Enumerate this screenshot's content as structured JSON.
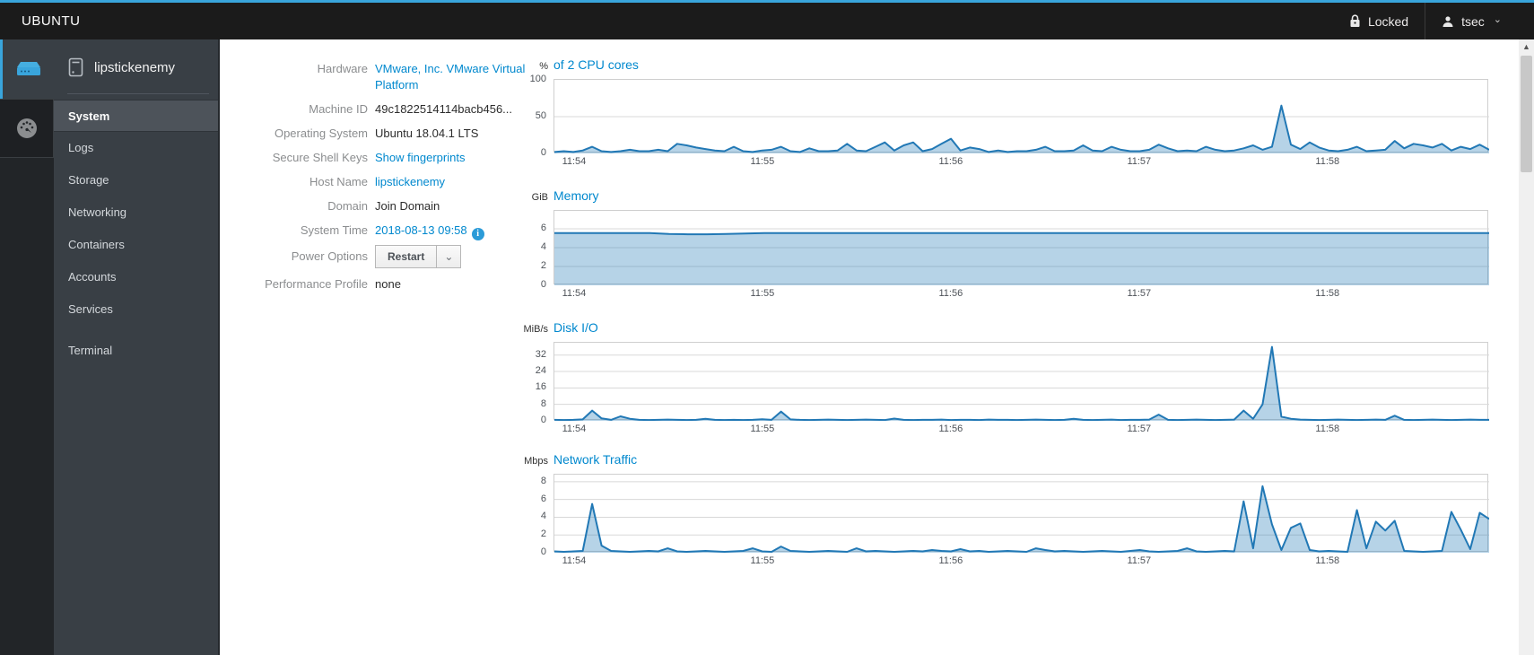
{
  "palette": {
    "accent": "#39a5dc",
    "link": "#0088ce",
    "chart_line": "#2178b5",
    "chart_fill": "rgba(33,120,181,0.33)",
    "grid": "#d8d8d8"
  },
  "topbar": {
    "brand": "UBUNTU",
    "locked_label": "Locked",
    "user_label": "tsec"
  },
  "sidebar": {
    "hostname": "lipstickenemy",
    "items": [
      {
        "label": "System",
        "selected": true
      },
      {
        "label": "Logs"
      },
      {
        "label": "Storage"
      },
      {
        "label": "Networking"
      },
      {
        "label": "Containers"
      },
      {
        "label": "Accounts"
      },
      {
        "label": "Services"
      },
      {
        "label": "Terminal",
        "gap": true
      }
    ]
  },
  "details": {
    "rows": [
      {
        "name": "hardware",
        "label": "Hardware",
        "value": "VMware, Inc. VMware Virtual Platform",
        "kind": "link"
      },
      {
        "name": "machine-id",
        "label": "Machine ID",
        "value": "49c1822514114bacb456...",
        "kind": "text"
      },
      {
        "name": "operating-system",
        "label": "Operating System",
        "value": "Ubuntu 18.04.1 LTS",
        "kind": "text"
      },
      {
        "name": "secure-shell-keys",
        "label": "Secure Shell Keys",
        "value": "Show fingerprints",
        "kind": "link"
      },
      {
        "name": "host-name",
        "label": "Host Name",
        "value": "lipstickenemy",
        "kind": "link"
      },
      {
        "name": "domain",
        "label": "Domain",
        "value": "Join Domain",
        "kind": "action"
      },
      {
        "name": "system-time",
        "label": "System Time",
        "value": "2018-08-13 09:58",
        "kind": "link",
        "info": true
      },
      {
        "name": "power-options",
        "label": "Power Options",
        "value": "Restart",
        "kind": "button"
      },
      {
        "name": "performance-profile",
        "label": "Performance Profile",
        "value": "none",
        "kind": "text"
      }
    ]
  },
  "chart_data": [
    {
      "type": "area",
      "unit": "%",
      "title": "of 2 CPU cores",
      "ylim": [
        0,
        100
      ],
      "yticks": [
        0,
        50,
        100
      ],
      "xticks": [
        "11:54",
        "11:55",
        "11:56",
        "11:57",
        "11:58"
      ],
      "xtick_fracs": [
        0.022,
        0.2235,
        0.425,
        0.6265,
        0.828
      ],
      "values": [
        2,
        3,
        2,
        4,
        9,
        3,
        2,
        3,
        5,
        3,
        3,
        5,
        3,
        13,
        11,
        8,
        6,
        4,
        3,
        9,
        3,
        2,
        4,
        5,
        9,
        3,
        2,
        7,
        3,
        3,
        4,
        13,
        4,
        3,
        9,
        15,
        4,
        11,
        15,
        3,
        6,
        13,
        20,
        4,
        8,
        6,
        2,
        4,
        2,
        3,
        3,
        5,
        9,
        3,
        3,
        4,
        11,
        4,
        3,
        9,
        5,
        3,
        3,
        5,
        12,
        7,
        3,
        4,
        3,
        9,
        5,
        3,
        4,
        7,
        11,
        5,
        9,
        65,
        12,
        6,
        15,
        8,
        4,
        3,
        5,
        9,
        3,
        4,
        5,
        17,
        7,
        13,
        11,
        8,
        13,
        4,
        9,
        6,
        12,
        5
      ]
    },
    {
      "type": "area",
      "unit": "GiB",
      "title": "Memory",
      "ylim": [
        0,
        7.9
      ],
      "yticks": [
        0,
        2,
        4,
        6
      ],
      "xticks": [
        "11:54",
        "11:55",
        "11:56",
        "11:57",
        "11:58"
      ],
      "xtick_fracs": [
        0.022,
        0.2235,
        0.425,
        0.6265,
        0.828
      ],
      "values": [
        5.55,
        5.55,
        5.55,
        5.55,
        5.55,
        5.55,
        5.45,
        5.42,
        5.42,
        5.45,
        5.5,
        5.55,
        5.55,
        5.55,
        5.55,
        5.55,
        5.55,
        5.55,
        5.55,
        5.55,
        5.55,
        5.55,
        5.55,
        5.55,
        5.55,
        5.55,
        5.55,
        5.55,
        5.55,
        5.55,
        5.55,
        5.55,
        5.55,
        5.55,
        5.55,
        5.55,
        5.55,
        5.55,
        5.55,
        5.55,
        5.55,
        5.55,
        5.55,
        5.55,
        5.55,
        5.55,
        5.55,
        5.55,
        5.55,
        5.55
      ]
    },
    {
      "type": "area",
      "unit": "MiB/s",
      "title": "Disk I/O",
      "ylim": [
        0,
        38
      ],
      "yticks": [
        0,
        8,
        16,
        24,
        32
      ],
      "xticks": [
        "11:54",
        "11:55",
        "11:56",
        "11:57",
        "11:58"
      ],
      "xtick_fracs": [
        0.022,
        0.2235,
        0.425,
        0.6265,
        0.828
      ],
      "values": [
        0.5,
        0.4,
        0.5,
        0.7,
        5,
        1.2,
        0.5,
        2.2,
        1,
        0.5,
        0.4,
        0.5,
        0.6,
        0.5,
        0.4,
        0.5,
        1,
        0.5,
        0.4,
        0.5,
        0.4,
        0.5,
        0.8,
        0.5,
        4.5,
        0.7,
        0.5,
        0.4,
        0.5,
        0.6,
        0.5,
        0.4,
        0.5,
        0.6,
        0.5,
        0.4,
        1.1,
        0.5,
        0.4,
        0.5,
        0.5,
        0.6,
        0.4,
        0.5,
        0.5,
        0.4,
        0.6,
        0.5,
        0.5,
        0.4,
        0.5,
        0.6,
        0.5,
        0.4,
        0.5,
        1,
        0.5,
        0.4,
        0.5,
        0.6,
        0.4,
        0.5,
        0.5,
        0.6,
        3,
        0.5,
        0.4,
        0.5,
        0.6,
        0.5,
        0.4,
        0.5,
        0.6,
        5,
        1,
        8,
        36,
        2,
        1,
        0.6,
        0.5,
        0.4,
        0.5,
        0.6,
        0.5,
        0.4,
        0.5,
        0.6,
        0.5,
        2.5,
        0.5,
        0.4,
        0.5,
        0.6,
        0.5,
        0.4,
        0.5,
        0.6,
        0.5,
        0.5
      ]
    },
    {
      "type": "area",
      "unit": "Mbps",
      "title": "Network Traffic",
      "ylim": [
        0,
        8.8
      ],
      "yticks": [
        0,
        2,
        4,
        6,
        8
      ],
      "xticks": [
        "11:54",
        "11:55",
        "11:56",
        "11:57",
        "11:58"
      ],
      "xtick_fracs": [
        0.022,
        0.2235,
        0.425,
        0.6265,
        0.828
      ],
      "values": [
        0.15,
        0.1,
        0.15,
        0.2,
        5.5,
        0.8,
        0.2,
        0.15,
        0.1,
        0.15,
        0.2,
        0.15,
        0.5,
        0.15,
        0.1,
        0.15,
        0.2,
        0.15,
        0.1,
        0.15,
        0.2,
        0.5,
        0.15,
        0.1,
        0.7,
        0.2,
        0.15,
        0.1,
        0.15,
        0.2,
        0.15,
        0.1,
        0.5,
        0.15,
        0.2,
        0.15,
        0.1,
        0.15,
        0.2,
        0.15,
        0.3,
        0.2,
        0.15,
        0.4,
        0.15,
        0.2,
        0.1,
        0.15,
        0.2,
        0.15,
        0.1,
        0.5,
        0.3,
        0.15,
        0.2,
        0.15,
        0.1,
        0.15,
        0.2,
        0.15,
        0.1,
        0.2,
        0.3,
        0.15,
        0.1,
        0.15,
        0.2,
        0.5,
        0.15,
        0.1,
        0.15,
        0.2,
        0.15,
        5.8,
        0.5,
        7.5,
        3.2,
        0.3,
        2.8,
        3.3,
        0.3,
        0.15,
        0.2,
        0.15,
        0.1,
        4.8,
        0.5,
        3.5,
        2.5,
        3.6,
        0.2,
        0.15,
        0.1,
        0.15,
        0.2,
        4.6,
        2.6,
        0.4,
        4.5,
        3.8
      ]
    }
  ]
}
